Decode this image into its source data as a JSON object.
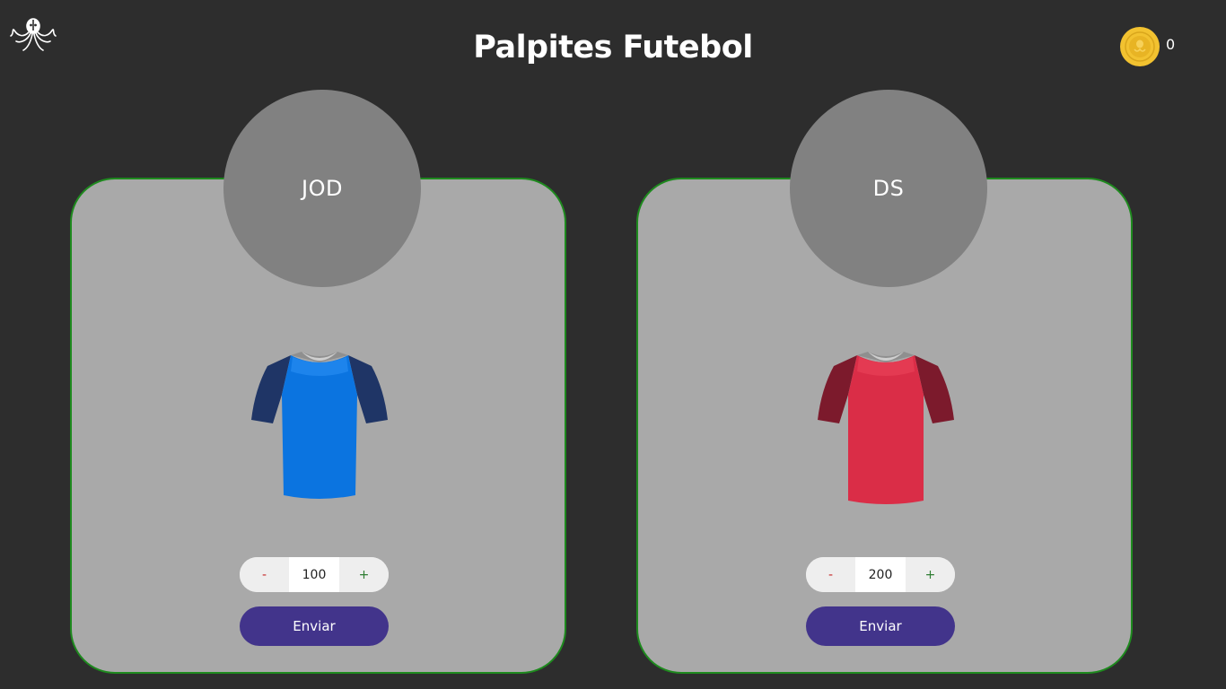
{
  "header": {
    "title": "Palpites Futebol",
    "logo_icon": "octopus-icon",
    "coin_icon": "gold-coin-icon",
    "coin_balance": "0"
  },
  "cards": [
    {
      "team": "JOD",
      "shirt_icon": "jersey-icon",
      "shirt_colors": {
        "body": "#0b74e0",
        "sleeves": "#1f3566"
      },
      "bet_value": "100",
      "minus_label": "-",
      "plus_label": "+",
      "submit_label": "Enviar"
    },
    {
      "team": "DS",
      "shirt_icon": "jersey-icon",
      "shirt_colors": {
        "body": "#da2d47",
        "sleeves": "#7c1a2c"
      },
      "bet_value": "200",
      "minus_label": "-",
      "plus_label": "+",
      "submit_label": "Enviar"
    }
  ],
  "colors": {
    "background": "#2d2d2d",
    "card": "#a9a9a9",
    "card_border": "#1e8a1e",
    "team_circle": "#818181",
    "button": "#42348b",
    "coin": "#f2c230"
  }
}
